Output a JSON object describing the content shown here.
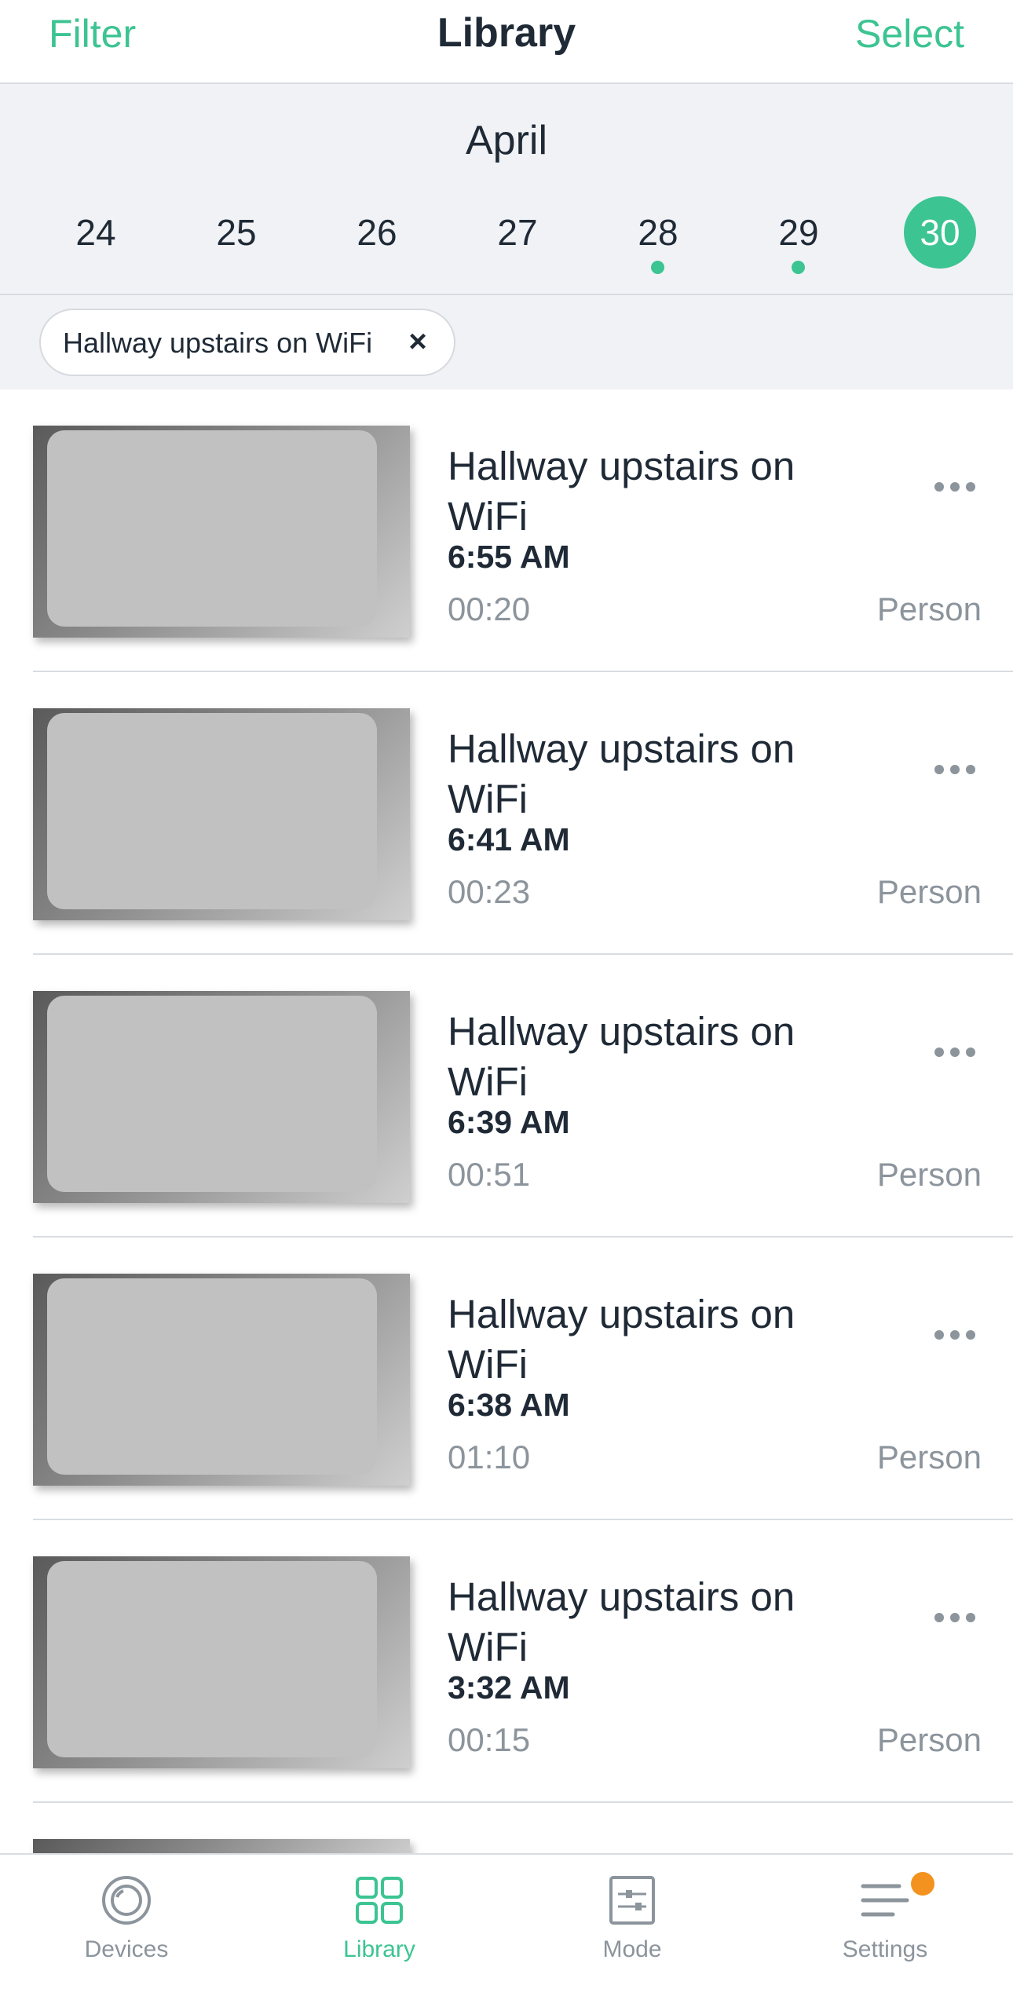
{
  "header": {
    "filter_label": "Filter",
    "title": "Library",
    "select_label": "Select"
  },
  "calendar": {
    "month": "April",
    "days": [
      {
        "label": "24",
        "has_event": false,
        "selected": false
      },
      {
        "label": "25",
        "has_event": false,
        "selected": false
      },
      {
        "label": "26",
        "has_event": false,
        "selected": false
      },
      {
        "label": "27",
        "has_event": false,
        "selected": false
      },
      {
        "label": "28",
        "has_event": true,
        "selected": false
      },
      {
        "label": "29",
        "has_event": true,
        "selected": false
      },
      {
        "label": "30",
        "has_event": false,
        "selected": true
      }
    ]
  },
  "filter_chip": {
    "label": "Hallway upstairs on WiFi",
    "close_icon": "close-icon"
  },
  "recordings": [
    {
      "title": "Hallway upstairs on WiFi",
      "time": "6:55 AM",
      "duration": "00:20",
      "tag": "Person"
    },
    {
      "title": "Hallway upstairs on WiFi",
      "time": "6:41 AM",
      "duration": "00:23",
      "tag": "Person"
    },
    {
      "title": "Hallway upstairs on WiFi",
      "time": "6:39 AM",
      "duration": "00:51",
      "tag": "Person"
    },
    {
      "title": "Hallway upstairs on WiFi",
      "time": "6:38 AM",
      "duration": "01:10",
      "tag": "Person"
    },
    {
      "title": "Hallway upstairs on WiFi",
      "time": "3:32 AM",
      "duration": "00:15",
      "tag": "Person"
    }
  ],
  "tabbar": {
    "tabs": [
      {
        "label": "Devices",
        "icon": "devices-icon",
        "active": false
      },
      {
        "label": "Library",
        "icon": "library-grid-icon",
        "active": true
      },
      {
        "label": "Mode",
        "icon": "mode-sliders-icon",
        "active": false
      },
      {
        "label": "Settings",
        "icon": "settings-menu-icon",
        "active": false
      }
    ]
  },
  "colors": {
    "accent": "#3cc492",
    "badge": "#f3921f",
    "text": "#1f2a36",
    "muted": "#8c949c"
  }
}
